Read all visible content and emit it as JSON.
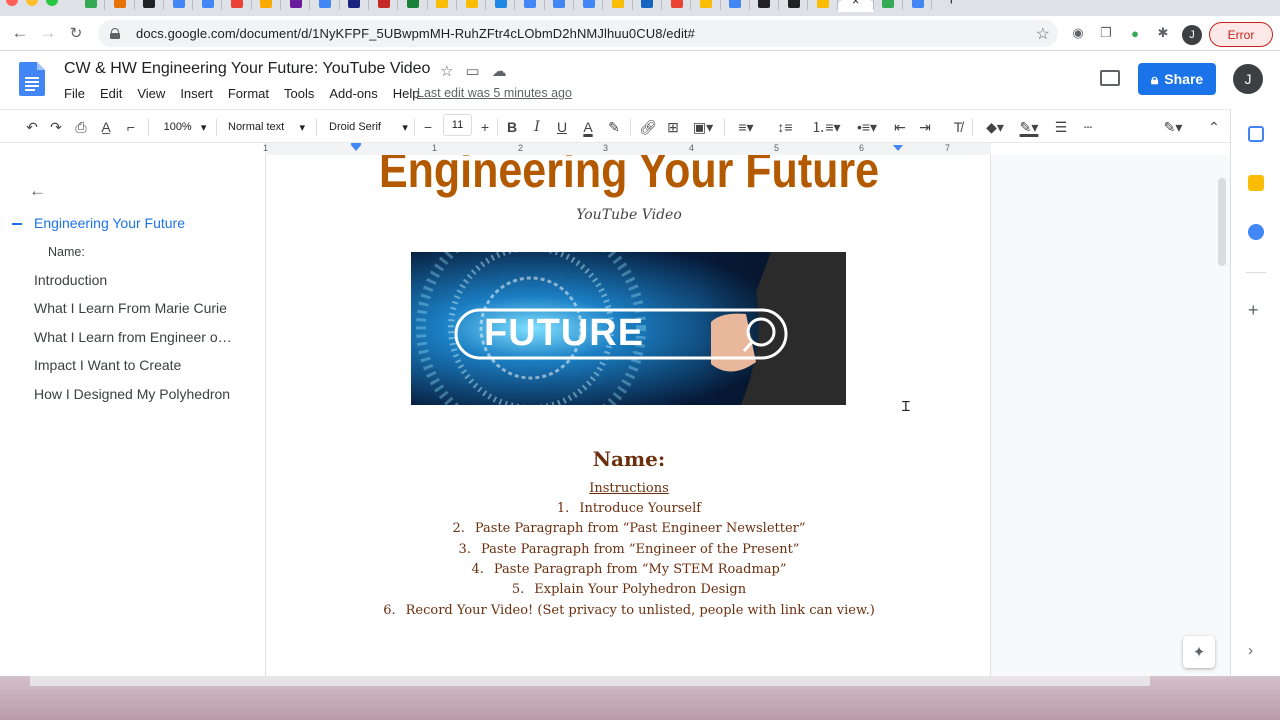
{
  "browser": {
    "url": "docs.google.com/document/d/1NyKFPF_5UBwpmMH-RuhZFtr4cLObmD2hNMJlhuu0CU8/edit#",
    "error_label": "Error",
    "profile_initial": "J",
    "tab_favicon_colors": [
      "#34a853",
      "#e8710a",
      "#202124",
      "#4285f4",
      "#4285f4",
      "#ea4335",
      "#f9ab00",
      "#6a1b9a",
      "#4285f4",
      "#1a237e",
      "#c62828",
      "#188038",
      "#fbbc04",
      "#fbbc04",
      "#1e88e5",
      "#4285f4",
      "#4285f4",
      "#4285f4",
      "#fbbc04",
      "#1565c0",
      "#ea4335",
      "#fbbc04",
      "#4285f4",
      "#202124",
      "#202124",
      "#fbbc04",
      "#34a853",
      "#4285f4"
    ]
  },
  "docs": {
    "title": "CW & HW Engineering Your Future: YouTube Video",
    "menu": [
      "File",
      "Edit",
      "View",
      "Insert",
      "Format",
      "Tools",
      "Add-ons",
      "Help"
    ],
    "last_edit": "Last edit was 5 minutes ago",
    "share_label": "Share",
    "account_initial": "J"
  },
  "toolbar": {
    "zoom": "100%",
    "style": "Normal text",
    "font": "Droid Serif",
    "font_size": "11"
  },
  "ruler": [
    "1",
    "1",
    "2",
    "3",
    "4",
    "5",
    "6",
    "7"
  ],
  "outline": {
    "items": [
      "Engineering Your Future",
      "Name:",
      "Introduction",
      "What I Learn From Marie Curie",
      "What I Learn from Engineer o…",
      "Impact I Want to Create",
      "How I Designed My Polyhedron"
    ]
  },
  "document": {
    "heading": "Engineering Your Future",
    "subtitle": "YouTube Video",
    "image_text": "FUTURE",
    "name_heading": "Name:",
    "instructions_title": "Instructions",
    "steps": [
      {
        "num": "1.",
        "text": "Introduce Yourself"
      },
      {
        "num": "2.",
        "text": "Paste Paragraph from “Past Engineer Newsletter”"
      },
      {
        "num": "3.",
        "text": "Paste Paragraph from “Engineer of the Present”"
      },
      {
        "num": "4.",
        "text": "Paste Paragraph from “My STEM Roadmap”"
      },
      {
        "num": "5.",
        "text": "Explain Your Polyhedron Design"
      },
      {
        "num": "6.",
        "text": "Record Your Video! (Set privacy to unlisted, people with link can view.)"
      }
    ]
  },
  "colors": {
    "heading": "#b35900",
    "body_text": "#6b2f0e",
    "accent": "#1a73e8"
  }
}
